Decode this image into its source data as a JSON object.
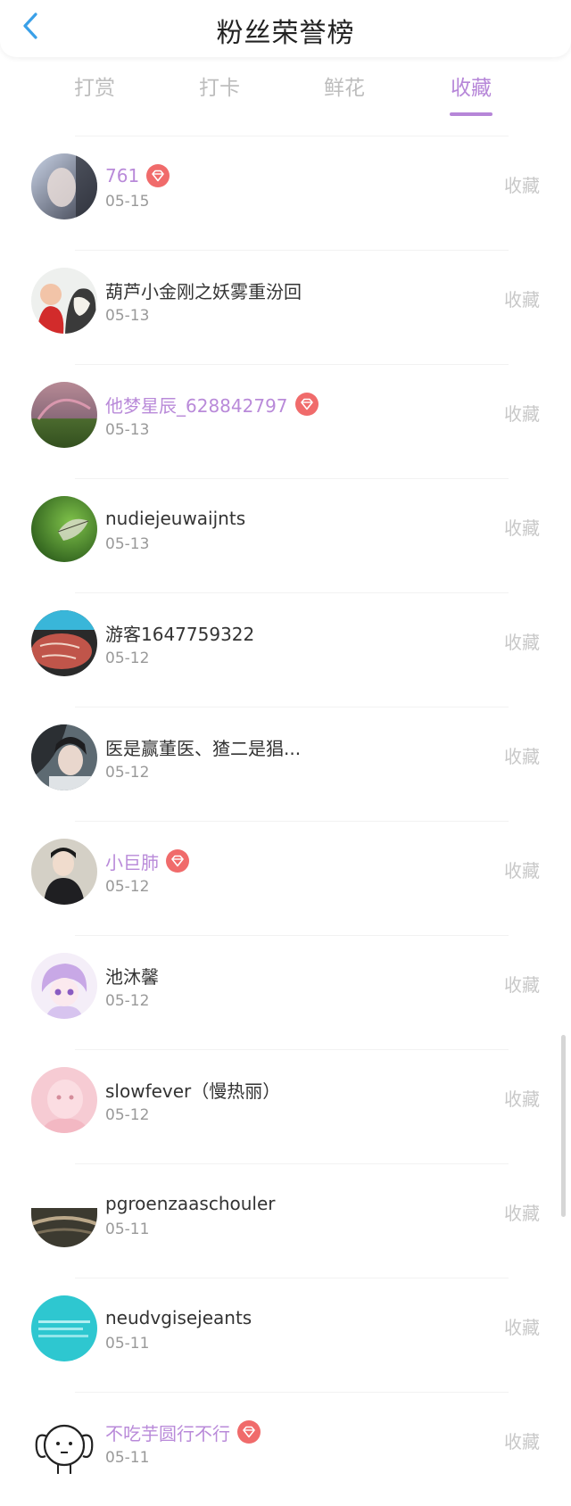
{
  "header": {
    "title": "粉丝荣誉榜",
    "back_icon": "chevron-left-icon"
  },
  "tabs": [
    {
      "label": "打赏",
      "active": false
    },
    {
      "label": "打卡",
      "active": false
    },
    {
      "label": "鲜花",
      "active": false
    },
    {
      "label": "收藏",
      "active": true
    }
  ],
  "colors": {
    "accent": "#b686d8",
    "vip_name": "#b98ad9",
    "vip_badge": "#f06b6b",
    "back_icon": "#3aa0e8"
  },
  "fans": [
    {
      "name": "761",
      "date": "05-15",
      "vip": true,
      "action": "收藏"
    },
    {
      "name": "葫芦小金刚之妖雾重汾回",
      "date": "05-13",
      "vip": false,
      "action": "收藏"
    },
    {
      "name": "他梦星辰_628842797",
      "date": "05-13",
      "vip": true,
      "action": "收藏"
    },
    {
      "name": "nudiejeuwaijnts",
      "date": "05-13",
      "vip": false,
      "action": "收藏"
    },
    {
      "name": "游客1647759322",
      "date": "05-12",
      "vip": false,
      "action": "收藏"
    },
    {
      "name": "医是赢董医、猹二是猖...",
      "date": "05-12",
      "vip": false,
      "action": "收藏"
    },
    {
      "name": "小巨肺",
      "date": "05-12",
      "vip": true,
      "action": "收藏"
    },
    {
      "name": "池沐馨",
      "date": "05-12",
      "vip": false,
      "action": "收藏"
    },
    {
      "name": "slowfever（慢热丽）",
      "date": "05-12",
      "vip": false,
      "action": "收藏"
    },
    {
      "name": "pgroenzaaschouler",
      "date": "05-11",
      "vip": false,
      "action": "收藏"
    },
    {
      "name": "neudvgisejeants",
      "date": "05-11",
      "vip": false,
      "action": "收藏"
    },
    {
      "name": "不吃芋圆行不行",
      "date": "05-11",
      "vip": true,
      "action": "收藏"
    }
  ]
}
